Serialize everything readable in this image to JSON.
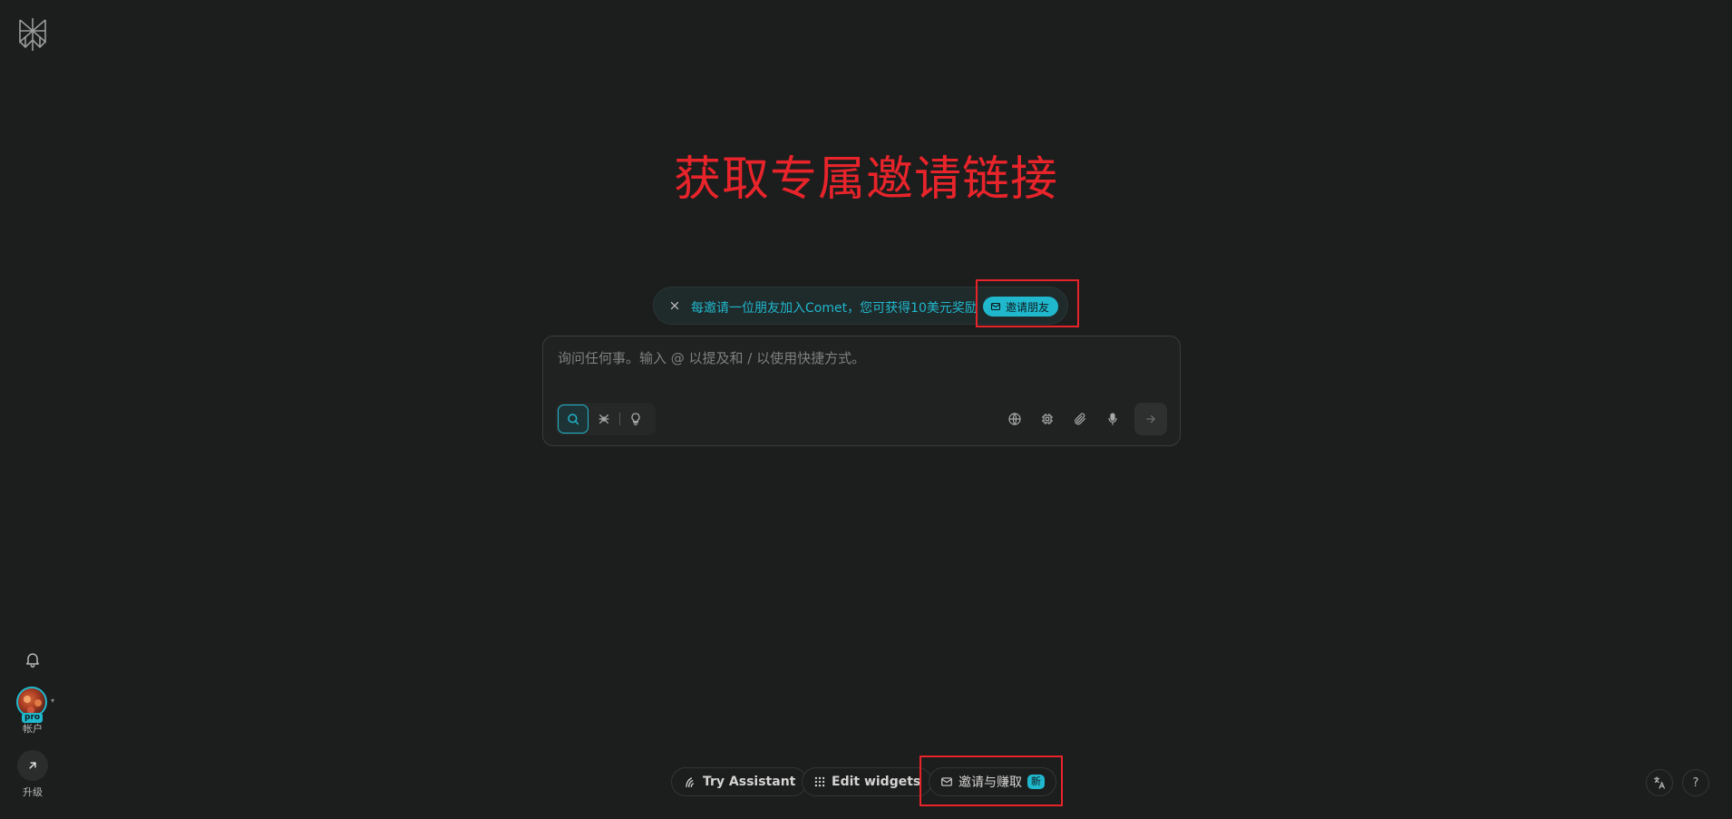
{
  "headline": "获取专属邀请链接",
  "banner": {
    "text": "每邀请一位朋友加入Comet，您可获得10美元奖励",
    "button_label": "邀请朋友"
  },
  "search": {
    "placeholder": "询问任何事。输入 @ 以提及和 / 以使用快捷方式。",
    "value": ""
  },
  "sidebar": {
    "account_label": "帐户",
    "pro_badge": "pro",
    "upgrade_label": "升级"
  },
  "bottom_bar": {
    "assistant_label": "Try Assistant",
    "widgets_label": "Edit widgets",
    "invite_label": "邀请与赚取",
    "new_badge": "新"
  },
  "corner": {
    "help_label": "?"
  },
  "colors": {
    "background": "#1c1d1d",
    "accent": "#20b8cd",
    "annotation_red": "#e8242b"
  },
  "icons": [
    "logo-icon",
    "bell-icon",
    "arrow-up-right-icon",
    "close-icon",
    "mail-icon",
    "search-icon",
    "research-icon",
    "lightbulb-icon",
    "globe-icon",
    "chip-icon",
    "paperclip-icon",
    "microphone-icon",
    "arrow-right-icon",
    "assistant-icon",
    "grid-icon",
    "translate-icon"
  ]
}
